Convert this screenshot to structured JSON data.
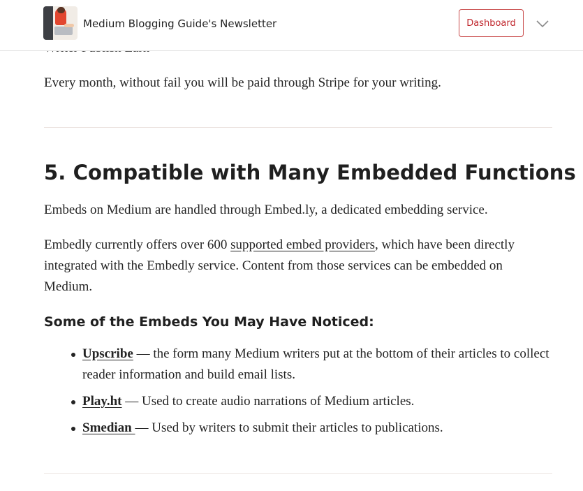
{
  "header": {
    "publication_name": "Medium Blogging Guide's Newsletter",
    "dashboard_label": "Dashboard",
    "logo_icon": "publication-logo",
    "menu_icon": "chevron-down-icon",
    "accent_color": "#c0272d"
  },
  "article": {
    "partial_line": "Writer Publish Earn",
    "stripe_paragraph": "Every month, without fail you will be paid through Stripe for your writing.",
    "section_heading": "5. Compatible with Many Embedded Functions",
    "embedly_intro": "Embeds on Medium are handled through Embed.ly, a dedicated embedding service.",
    "providers_paragraph": {
      "before": "Embedly currently offers over 600 ",
      "link": "supported embed providers",
      "after": ", which have been directly integrated with the Embedly service. Content from those services can be embedded on Medium."
    },
    "subheading": "Some of the Embeds You May Have Noticed:",
    "embeds": [
      {
        "name": "Upscribe",
        "description": " — the form many Medium writers put at the bottom of their articles to collect reader information and build email lists."
      },
      {
        "name": "Play.ht",
        "description": " — Used to create audio narrations of Medium articles."
      },
      {
        "name": "Smedian ",
        "description": "— Used by writers to submit their articles to publications."
      }
    ]
  }
}
